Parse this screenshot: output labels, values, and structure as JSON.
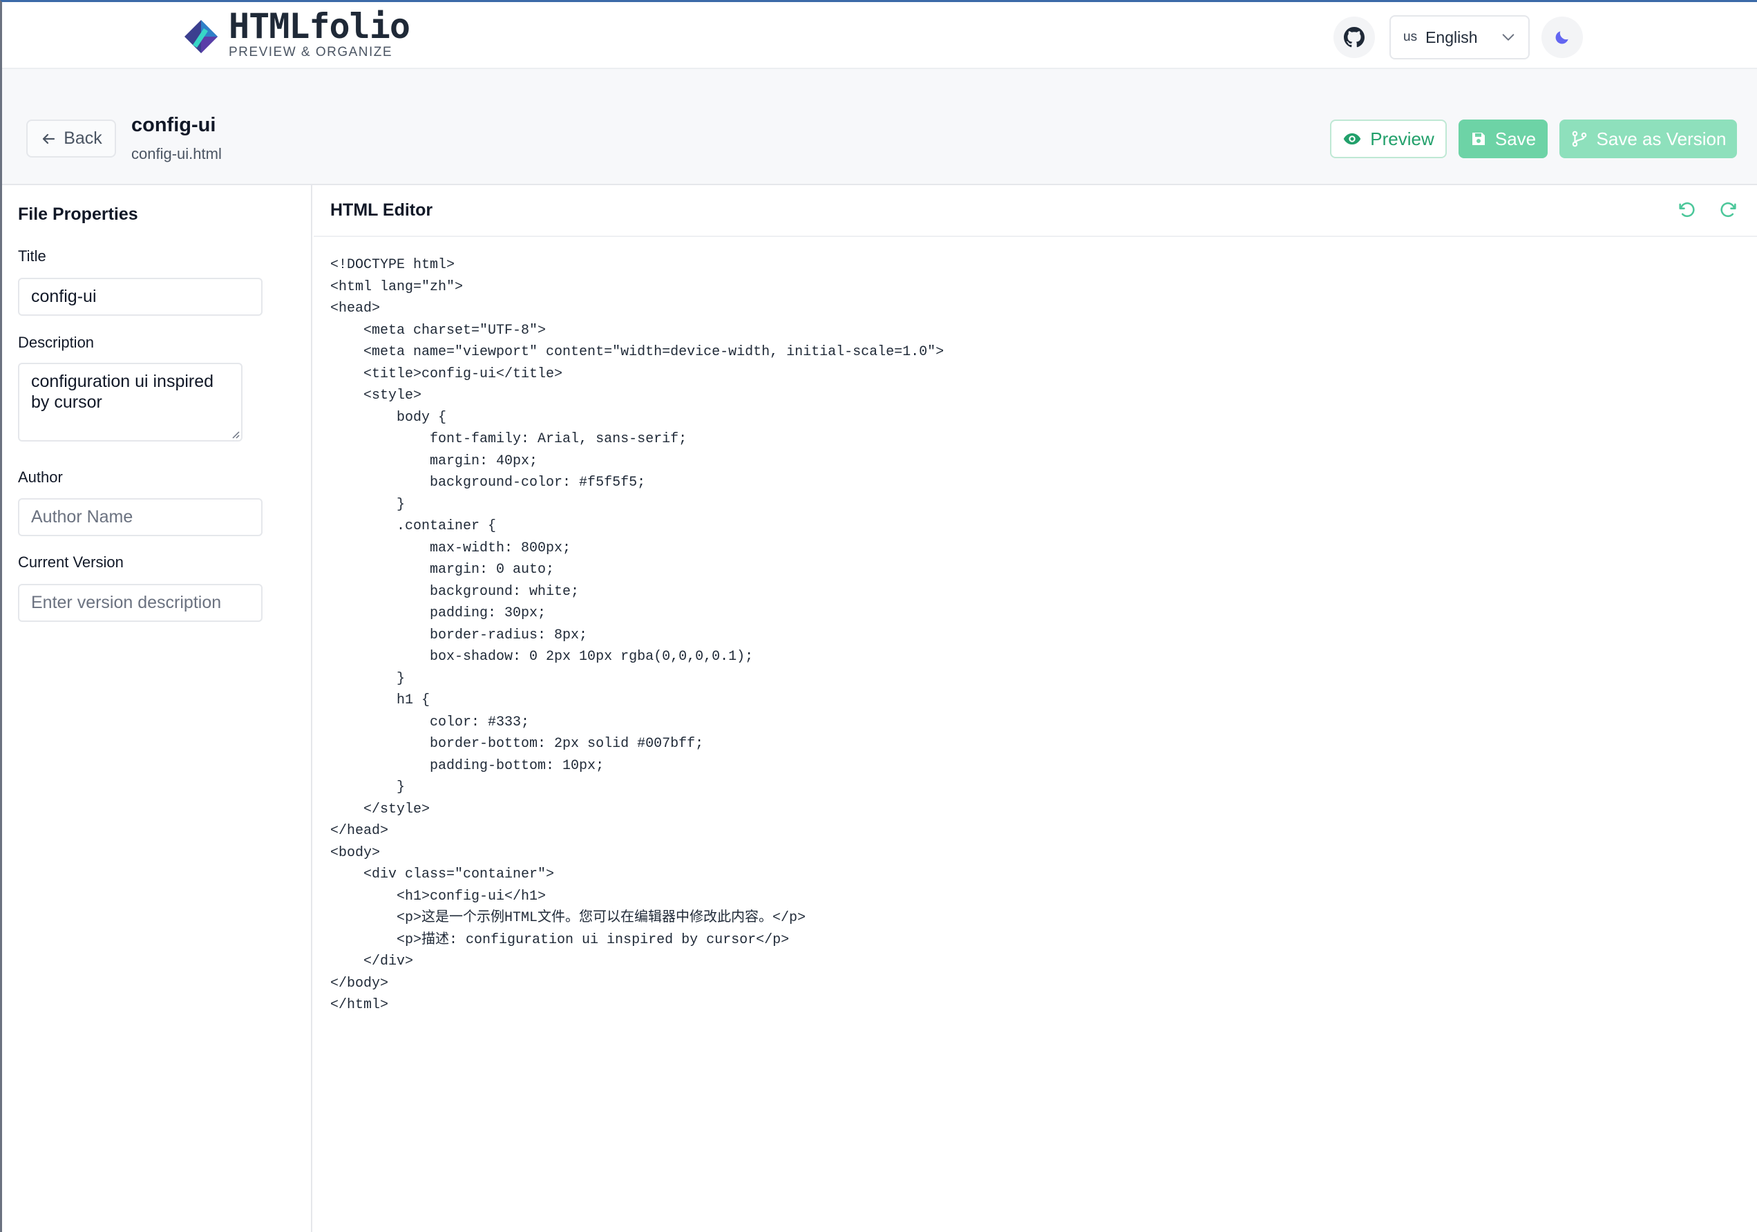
{
  "navbar": {
    "logo_title": "HTMLfolio",
    "logo_subtitle": "PREVIEW & ORGANIZE",
    "github_icon": "github-icon",
    "language": {
      "flag": "us",
      "label": "English"
    },
    "theme_icon": "moon-icon"
  },
  "toolbar": {
    "back_label": "Back",
    "title": "config-ui",
    "filename": "config-ui.html",
    "preview_label": "Preview",
    "save_label": "Save",
    "save_version_label": "Save as Version"
  },
  "sidebar": {
    "heading": "File Properties",
    "title_label": "Title",
    "title_value": "config-ui",
    "description_label": "Description",
    "description_value": "configuration ui inspired by cursor",
    "author_label": "Author",
    "author_placeholder": "Author Name",
    "version_label": "Current Version",
    "version_placeholder": "Enter version description"
  },
  "editor": {
    "title": "HTML Editor",
    "lines": [
      "<!DOCTYPE html>",
      "<html lang=\"zh\">",
      "<head>",
      "    <meta charset=\"UTF-8\">",
      "    <meta name=\"viewport\" content=\"width=device-width, initial-scale=1.0\">",
      "    <title>config-ui</title>",
      "    <style>",
      "        body {",
      "            font-family: Arial, sans-serif;",
      "            margin: 40px;",
      "            background-color: #f5f5f5;",
      "        }",
      "        .container {",
      "            max-width: 800px;",
      "            margin: 0 auto;",
      "            background: white;",
      "            padding: 30px;",
      "            border-radius: 8px;",
      "            box-shadow: 0 2px 10px rgba(0,0,0,0.1);",
      "        }",
      "        h1 {",
      "            color: #333;",
      "            border-bottom: 2px solid #007bff;",
      "            padding-bottom: 10px;",
      "        }",
      "    </style>",
      "</head>",
      "<body>",
      "    <div class=\"container\">",
      "        <h1>config-ui</h1>",
      "        <p>这是一个示例HTML文件。您可以在编辑器中修改此内容。</p>",
      "        <p>描述: configuration ui inspired by cursor</p>",
      "    </div>",
      "</body>",
      "</html>"
    ]
  },
  "colors": {
    "accent": "#22a06b",
    "save_bg": "#6dd3a6",
    "save_version_bg": "#8ee0bc",
    "theme_icon": "#6366f1"
  }
}
